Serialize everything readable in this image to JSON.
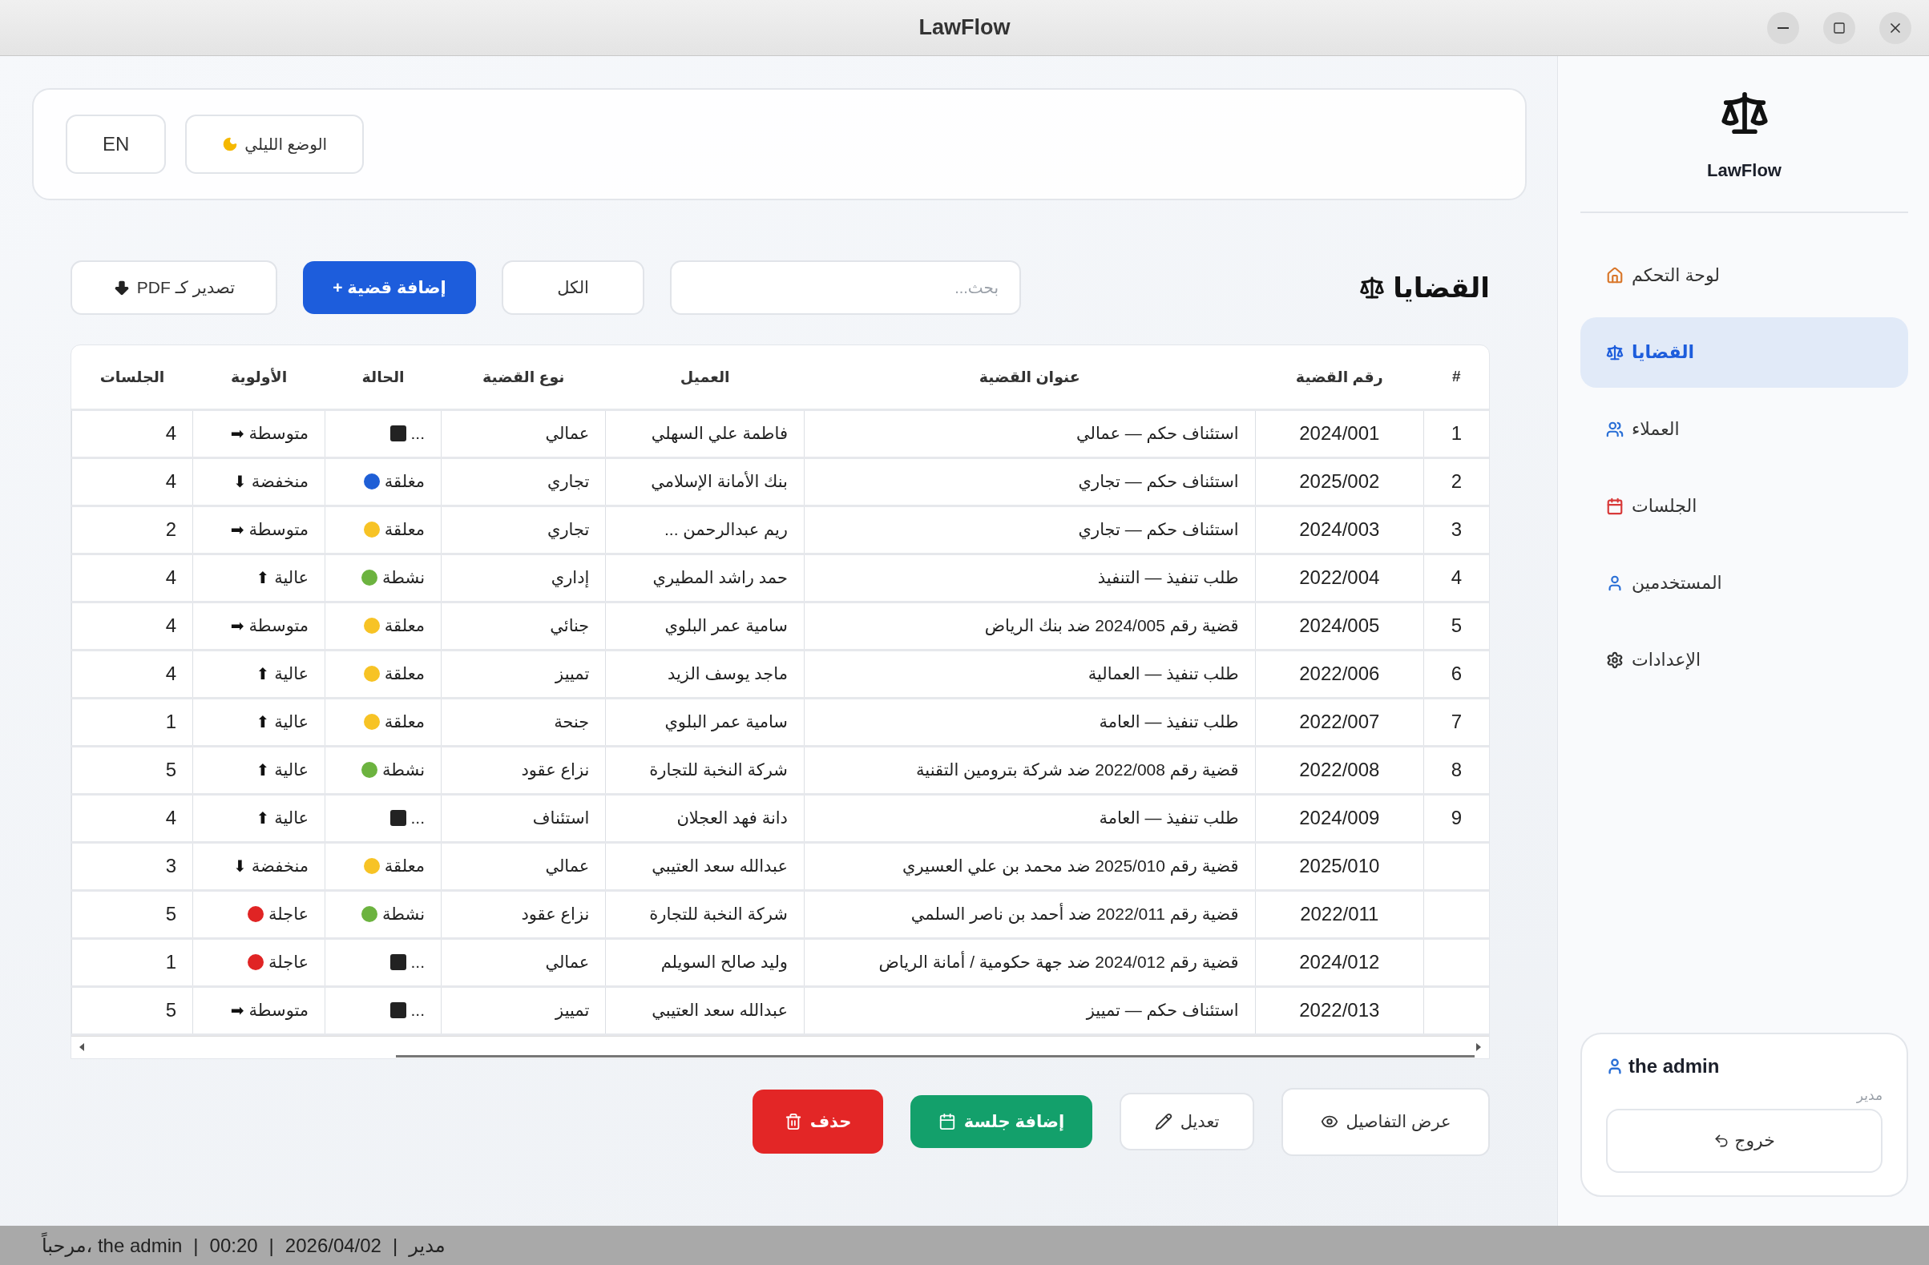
{
  "window": {
    "title": "LawFlow"
  },
  "header_bar": {
    "buttons": [
      {
        "kind": "theme",
        "label": "الوضع الليلي"
      },
      {
        "kind": "lang",
        "label": "EN"
      }
    ]
  },
  "page": {
    "title": "القضايا",
    "search": {
      "placeholder": "بحث..."
    },
    "filter": {
      "label": "الكل"
    },
    "buttons": [
      {
        "kind": "add",
        "label": "إضافة قضية +"
      },
      {
        "kind": "export",
        "label": "تصدير كـ PDF"
      }
    ]
  },
  "table": {
    "columns": [
      "#",
      "رقم القضية",
      "عنوان القضية",
      "العميل",
      "نوع القضية",
      "الحالة",
      "الأولوية",
      "الجلسات"
    ],
    "rows": [
      {
        "index": "1",
        "number": "2024/001",
        "title": "استئناف حكم — عمالي",
        "client": "فاطمة علي السهلي",
        "type": "عمالي",
        "status": {
          "kind": "square",
          "label": "..."
        },
        "priority": {
          "kind": "arrow",
          "icon": "➡",
          "label": "متوسطة"
        },
        "sessions": "4"
      },
      {
        "index": "2",
        "number": "2025/002",
        "title": "استئناف حكم — تجاري",
        "client": "بنك الأمانة الإسلامي",
        "type": "تجاري",
        "status": {
          "kind": "dot",
          "color": "#1f5fd6",
          "label": "مغلقة"
        },
        "priority": {
          "kind": "arrow",
          "icon": "⬇",
          "label": "منخفضة"
        },
        "sessions": "4"
      },
      {
        "index": "3",
        "number": "2024/003",
        "title": "استئناف حكم — تجاري",
        "client": "ريم عبدالرحمن ...",
        "type": "تجاري",
        "status": {
          "kind": "dot",
          "color": "#f7c325",
          "label": "معلقة"
        },
        "priority": {
          "kind": "arrow",
          "icon": "➡",
          "label": "متوسطة"
        },
        "sessions": "2"
      },
      {
        "index": "4",
        "number": "2022/004",
        "title": "طلب تنفيذ — التنفيذ",
        "client": "حمد راشد المطيري",
        "type": "إداري",
        "status": {
          "kind": "dot",
          "color": "#6cb33f",
          "label": "نشطة"
        },
        "priority": {
          "kind": "arrow",
          "icon": "⬆",
          "label": "عالية"
        },
        "sessions": "4"
      },
      {
        "index": "5",
        "number": "2024/005",
        "title": "قضية رقم 2024/005 ضد بنك الرياض",
        "client": "سامية عمر البلوي",
        "type": "جنائي",
        "status": {
          "kind": "dot",
          "color": "#f7c325",
          "label": "معلقة"
        },
        "priority": {
          "kind": "arrow",
          "icon": "➡",
          "label": "متوسطة"
        },
        "sessions": "4"
      },
      {
        "index": "6",
        "number": "2022/006",
        "title": "طلب تنفيذ — العمالية",
        "client": "ماجد يوسف الزيد",
        "type": "تمييز",
        "status": {
          "kind": "dot",
          "color": "#f7c325",
          "label": "معلقة"
        },
        "priority": {
          "kind": "arrow",
          "icon": "⬆",
          "label": "عالية"
        },
        "sessions": "4"
      },
      {
        "index": "7",
        "number": "2022/007",
        "title": "طلب تنفيذ — العامة",
        "client": "سامية عمر البلوي",
        "type": "جنحة",
        "status": {
          "kind": "dot",
          "color": "#f7c325",
          "label": "معلقة"
        },
        "priority": {
          "kind": "arrow",
          "icon": "⬆",
          "label": "عالية"
        },
        "sessions": "1"
      },
      {
        "index": "8",
        "number": "2022/008",
        "title": "قضية رقم 2022/008 ضد شركة بترومين التقنية",
        "client": "شركة النخبة للتجارة",
        "type": "نزاع عقود",
        "status": {
          "kind": "dot",
          "color": "#6cb33f",
          "label": "نشطة"
        },
        "priority": {
          "kind": "arrow",
          "icon": "⬆",
          "label": "عالية"
        },
        "sessions": "5"
      },
      {
        "index": "9",
        "number": "2024/009",
        "title": "طلب تنفيذ — العامة",
        "client": "دانة فهد العجلان",
        "type": "استئناف",
        "status": {
          "kind": "square",
          "label": "..."
        },
        "priority": {
          "kind": "arrow",
          "icon": "⬆",
          "label": "عالية"
        },
        "sessions": "4"
      },
      {
        "number": "2025/010",
        "title": "قضية رقم 2025/010 ضد محمد بن علي العسيري",
        "client": "عبدالله سعد العتيبي",
        "type": "عمالي",
        "status": {
          "kind": "dot",
          "color": "#f7c325",
          "label": "معلقة"
        },
        "priority": {
          "kind": "arrow",
          "icon": "⬇",
          "label": "منخفضة"
        },
        "sessions": "3"
      },
      {
        "number": "2022/011",
        "title": "قضية رقم 2022/011 ضد أحمد بن ناصر السلمي",
        "client": "شركة النخبة للتجارة",
        "type": "نزاع عقود",
        "status": {
          "kind": "dot",
          "color": "#6cb33f",
          "label": "نشطة"
        },
        "priority": {
          "kind": "dot",
          "color": "#e02424",
          "label": "عاجلة"
        },
        "sessions": "5"
      },
      {
        "number": "2024/012",
        "title": "قضية رقم 2024/012 ضد جهة حكومية / أمانة الرياض",
        "client": "وليد صالح السويلم",
        "type": "عمالي",
        "status": {
          "kind": "square",
          "label": "..."
        },
        "priority": {
          "kind": "dot",
          "color": "#e02424",
          "label": "عاجلة"
        },
        "sessions": "1"
      },
      {
        "number": "2022/013",
        "title": "استئناف حكم — تمييز",
        "client": "عبدالله سعد العتيبي",
        "type": "تمييز",
        "status": {
          "kind": "square",
          "label": "..."
        },
        "priority": {
          "kind": "arrow",
          "icon": "➡",
          "label": "متوسطة"
        },
        "sessions": "5"
      }
    ]
  },
  "actions": [
    {
      "kind": "view",
      "label": "عرض التفاصيل"
    },
    {
      "kind": "edit",
      "label": "تعديل"
    },
    {
      "kind": "session",
      "label": "إضافة جلسة"
    },
    {
      "kind": "delete",
      "label": "حذف"
    }
  ],
  "sidebar": {
    "brand": "LawFlow",
    "items": [
      {
        "kind": "home",
        "label": "لوحة التحكم",
        "selected": false
      },
      {
        "kind": "cases",
        "label": "القضايا",
        "selected": true
      },
      {
        "kind": "clients",
        "label": "العملاء",
        "selected": false
      },
      {
        "kind": "sessions",
        "label": "الجلسات",
        "selected": false
      },
      {
        "kind": "users",
        "label": "المستخدمين",
        "selected": false
      },
      {
        "kind": "settings",
        "label": "الإعدادات",
        "selected": false
      }
    ],
    "user": {
      "name": "the admin",
      "role": "مدير",
      "logout": "خروج"
    }
  },
  "status_bar": {
    "items": [
      "مدير",
      "2026/04/02",
      "00:20",
      "مرحباً، the admin"
    ],
    "separator": "|"
  }
}
